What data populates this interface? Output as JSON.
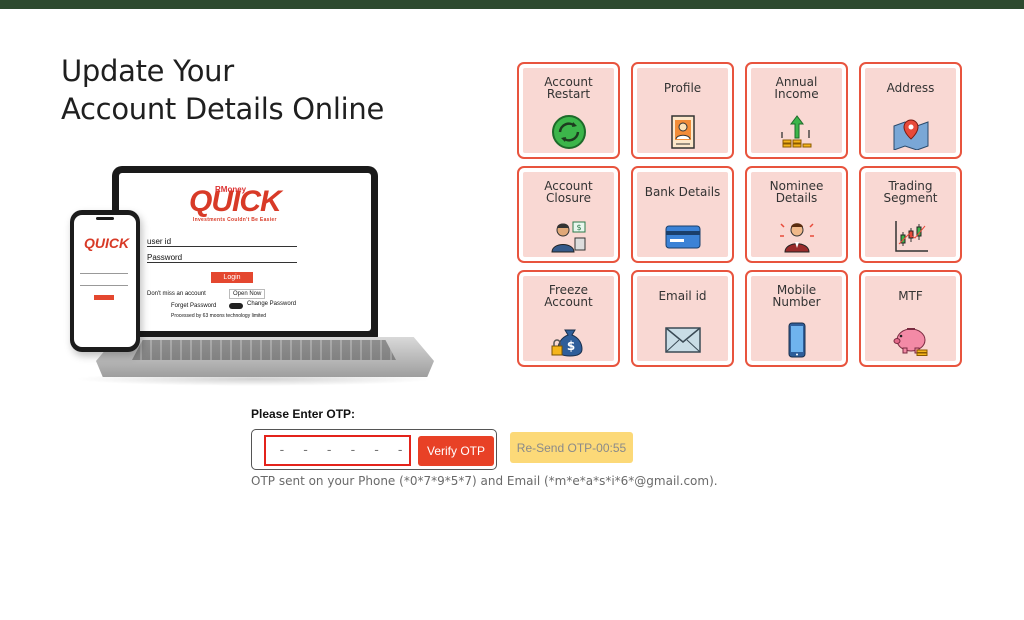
{
  "headline": {
    "line1": "Update Your",
    "line2": "Account Details Online"
  },
  "illustration": {
    "brand_top": "RMoney",
    "brand_name": "QUICK",
    "brand_tagline": "Investments Couldn't Be Easier",
    "user_label": "user id",
    "password_label": "Password",
    "login_label": "Login",
    "no_account_text": "Don't miss an account",
    "open_now_label": "Open Now",
    "forgot_label": "Forget Password",
    "change_label": "Change Password",
    "processed_text": "Processed by 63 moons technology limited"
  },
  "cards": [
    {
      "label": "Account Restart",
      "icon": "refresh-icon",
      "lines": 2
    },
    {
      "label": "Profile",
      "icon": "profile-icon",
      "lines": 1
    },
    {
      "label": "Annual Income",
      "icon": "income-icon",
      "lines": 2
    },
    {
      "label": "Address",
      "icon": "map-pin-icon",
      "lines": 1
    },
    {
      "label": "Account Closure",
      "icon": "closure-icon",
      "lines": 2
    },
    {
      "label": "Bank Details",
      "icon": "credit-card-icon",
      "lines": 1
    },
    {
      "label": "Nominee Details",
      "icon": "nominee-icon",
      "lines": 2
    },
    {
      "label": "Trading Segment",
      "icon": "candlestick-icon",
      "lines": 2
    },
    {
      "label": "Freeze Account",
      "icon": "money-lock-icon",
      "lines": 2
    },
    {
      "label": "Email id",
      "icon": "envelope-icon",
      "lines": 1
    },
    {
      "label": "Mobile Number",
      "icon": "mobile-icon",
      "lines": 2
    },
    {
      "label": "MTF",
      "icon": "piggy-bank-icon",
      "lines": 1
    }
  ],
  "otp": {
    "title": "Please Enter OTP:",
    "placeholder": "- - - - - -",
    "verify_label": "Verify OTP",
    "resend_label": "Re-Send OTP-00:55",
    "note": "OTP sent on your Phone (*0*7*9*5*7) and Email (*m*e*a*s*i*6*@gmail.com)."
  },
  "colors": {
    "topbar": "#2e4a2f",
    "card_border": "#e8543e",
    "card_fill": "#f9d8d3",
    "verify": "#e84126",
    "resend": "#fcd978"
  }
}
